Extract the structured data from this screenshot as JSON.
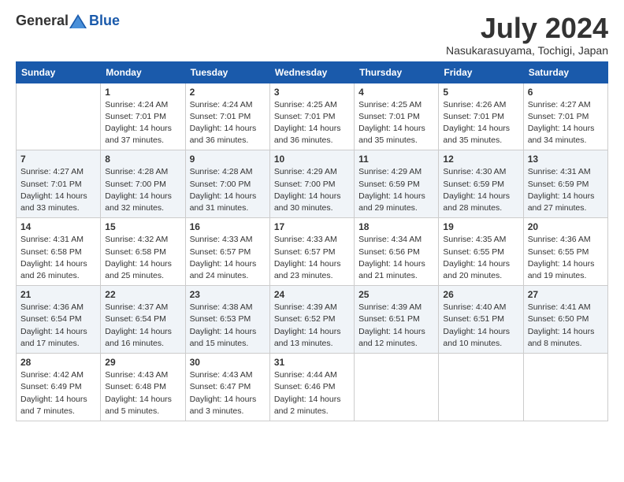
{
  "header": {
    "logo_general": "General",
    "logo_blue": "Blue",
    "month_title": "July 2024",
    "location": "Nasukarasuyama, Tochigi, Japan"
  },
  "weekdays": [
    "Sunday",
    "Monday",
    "Tuesday",
    "Wednesday",
    "Thursday",
    "Friday",
    "Saturday"
  ],
  "weeks": [
    [
      {
        "day": "",
        "info": ""
      },
      {
        "day": "1",
        "info": "Sunrise: 4:24 AM\nSunset: 7:01 PM\nDaylight: 14 hours\nand 37 minutes."
      },
      {
        "day": "2",
        "info": "Sunrise: 4:24 AM\nSunset: 7:01 PM\nDaylight: 14 hours\nand 36 minutes."
      },
      {
        "day": "3",
        "info": "Sunrise: 4:25 AM\nSunset: 7:01 PM\nDaylight: 14 hours\nand 36 minutes."
      },
      {
        "day": "4",
        "info": "Sunrise: 4:25 AM\nSunset: 7:01 PM\nDaylight: 14 hours\nand 35 minutes."
      },
      {
        "day": "5",
        "info": "Sunrise: 4:26 AM\nSunset: 7:01 PM\nDaylight: 14 hours\nand 35 minutes."
      },
      {
        "day": "6",
        "info": "Sunrise: 4:27 AM\nSunset: 7:01 PM\nDaylight: 14 hours\nand 34 minutes."
      }
    ],
    [
      {
        "day": "7",
        "info": "Sunrise: 4:27 AM\nSunset: 7:01 PM\nDaylight: 14 hours\nand 33 minutes."
      },
      {
        "day": "8",
        "info": "Sunrise: 4:28 AM\nSunset: 7:00 PM\nDaylight: 14 hours\nand 32 minutes."
      },
      {
        "day": "9",
        "info": "Sunrise: 4:28 AM\nSunset: 7:00 PM\nDaylight: 14 hours\nand 31 minutes."
      },
      {
        "day": "10",
        "info": "Sunrise: 4:29 AM\nSunset: 7:00 PM\nDaylight: 14 hours\nand 30 minutes."
      },
      {
        "day": "11",
        "info": "Sunrise: 4:29 AM\nSunset: 6:59 PM\nDaylight: 14 hours\nand 29 minutes."
      },
      {
        "day": "12",
        "info": "Sunrise: 4:30 AM\nSunset: 6:59 PM\nDaylight: 14 hours\nand 28 minutes."
      },
      {
        "day": "13",
        "info": "Sunrise: 4:31 AM\nSunset: 6:59 PM\nDaylight: 14 hours\nand 27 minutes."
      }
    ],
    [
      {
        "day": "14",
        "info": "Sunrise: 4:31 AM\nSunset: 6:58 PM\nDaylight: 14 hours\nand 26 minutes."
      },
      {
        "day": "15",
        "info": "Sunrise: 4:32 AM\nSunset: 6:58 PM\nDaylight: 14 hours\nand 25 minutes."
      },
      {
        "day": "16",
        "info": "Sunrise: 4:33 AM\nSunset: 6:57 PM\nDaylight: 14 hours\nand 24 minutes."
      },
      {
        "day": "17",
        "info": "Sunrise: 4:33 AM\nSunset: 6:57 PM\nDaylight: 14 hours\nand 23 minutes."
      },
      {
        "day": "18",
        "info": "Sunrise: 4:34 AM\nSunset: 6:56 PM\nDaylight: 14 hours\nand 21 minutes."
      },
      {
        "day": "19",
        "info": "Sunrise: 4:35 AM\nSunset: 6:55 PM\nDaylight: 14 hours\nand 20 minutes."
      },
      {
        "day": "20",
        "info": "Sunrise: 4:36 AM\nSunset: 6:55 PM\nDaylight: 14 hours\nand 19 minutes."
      }
    ],
    [
      {
        "day": "21",
        "info": "Sunrise: 4:36 AM\nSunset: 6:54 PM\nDaylight: 14 hours\nand 17 minutes."
      },
      {
        "day": "22",
        "info": "Sunrise: 4:37 AM\nSunset: 6:54 PM\nDaylight: 14 hours\nand 16 minutes."
      },
      {
        "day": "23",
        "info": "Sunrise: 4:38 AM\nSunset: 6:53 PM\nDaylight: 14 hours\nand 15 minutes."
      },
      {
        "day": "24",
        "info": "Sunrise: 4:39 AM\nSunset: 6:52 PM\nDaylight: 14 hours\nand 13 minutes."
      },
      {
        "day": "25",
        "info": "Sunrise: 4:39 AM\nSunset: 6:51 PM\nDaylight: 14 hours\nand 12 minutes."
      },
      {
        "day": "26",
        "info": "Sunrise: 4:40 AM\nSunset: 6:51 PM\nDaylight: 14 hours\nand 10 minutes."
      },
      {
        "day": "27",
        "info": "Sunrise: 4:41 AM\nSunset: 6:50 PM\nDaylight: 14 hours\nand 8 minutes."
      }
    ],
    [
      {
        "day": "28",
        "info": "Sunrise: 4:42 AM\nSunset: 6:49 PM\nDaylight: 14 hours\nand 7 minutes."
      },
      {
        "day": "29",
        "info": "Sunrise: 4:43 AM\nSunset: 6:48 PM\nDaylight: 14 hours\nand 5 minutes."
      },
      {
        "day": "30",
        "info": "Sunrise: 4:43 AM\nSunset: 6:47 PM\nDaylight: 14 hours\nand 3 minutes."
      },
      {
        "day": "31",
        "info": "Sunrise: 4:44 AM\nSunset: 6:46 PM\nDaylight: 14 hours\nand 2 minutes."
      },
      {
        "day": "",
        "info": ""
      },
      {
        "day": "",
        "info": ""
      },
      {
        "day": "",
        "info": ""
      }
    ]
  ]
}
